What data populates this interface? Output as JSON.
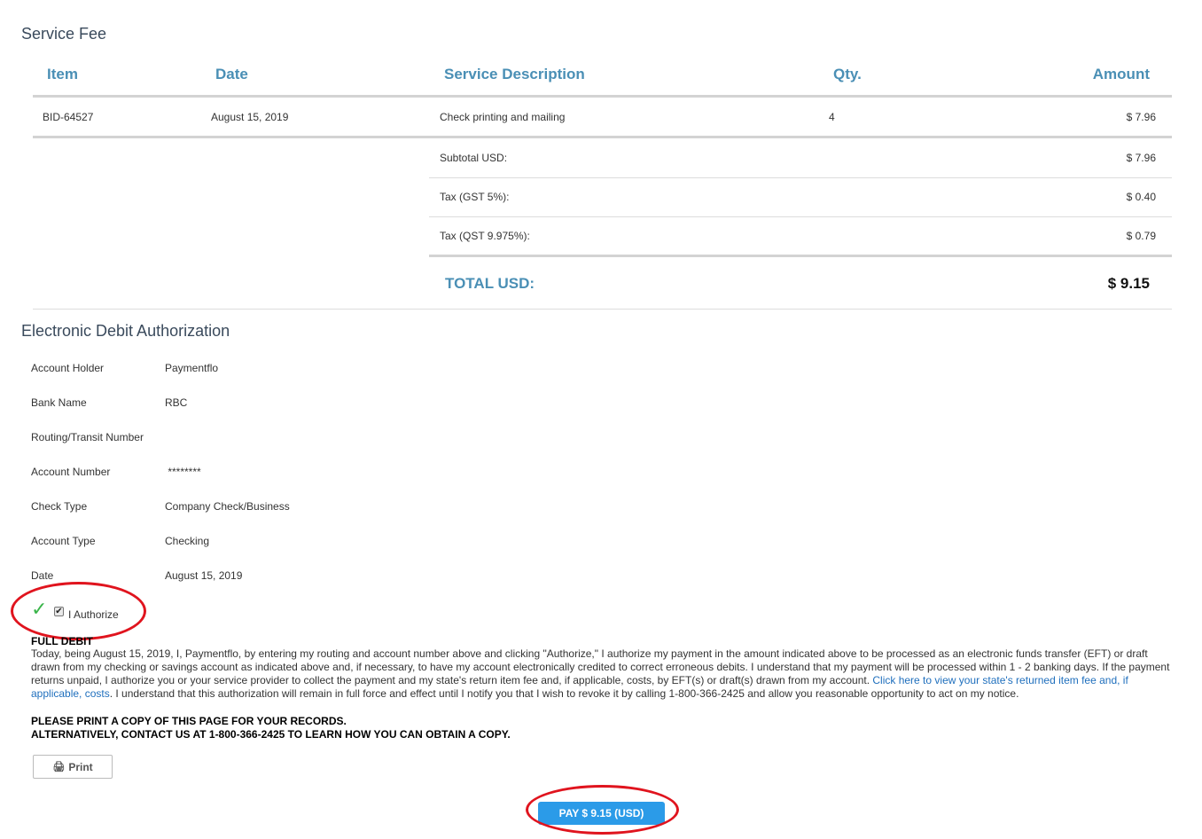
{
  "service_fee": {
    "title": "Service Fee",
    "columns": {
      "item": "Item",
      "date": "Date",
      "description": "Service Description",
      "qty": "Qty.",
      "amount": "Amount"
    },
    "rows": [
      {
        "item": "BID-64527",
        "date": "August 15, 2019",
        "description": "Check printing and mailing",
        "qty": "4",
        "amount": "$ 7.96"
      }
    ],
    "summary": {
      "subtotal_label": "Subtotal USD:",
      "subtotal_value": "$ 7.96",
      "tax_gst_label": "Tax (GST 5%):",
      "tax_gst_value": "$ 0.40",
      "tax_qst_label": "Tax (QST 9.975%):",
      "tax_qst_value": "$ 0.79",
      "total_label": "TOTAL USD:",
      "total_value": "$ 9.15"
    }
  },
  "authorization": {
    "title": "Electronic Debit Authorization",
    "fields": [
      {
        "label": "Account Holder",
        "value": "Paymentflo"
      },
      {
        "label": "Bank Name",
        "value": "RBC"
      },
      {
        "label": "Routing/Transit Number",
        "value": ""
      },
      {
        "label": "Account Number",
        "value": " ********"
      },
      {
        "label": "Check Type",
        "value": "Company Check/Business"
      },
      {
        "label": "Account Type",
        "value": "Checking"
      },
      {
        "label": "Date",
        "value": "August 15, 2019"
      }
    ],
    "checkmark_icon": "✓",
    "checkbox_glyph": "✔",
    "authorize_label": "I Authorize",
    "authorize_checked": true,
    "full_debit_heading": "FULL DEBIT",
    "legal_text": "Today, being August 15, 2019, I, Paymentflo, by entering my routing and account number above and clicking \"Authorize,\" I authorize my payment in the amount indicated above to be processed as an electronic funds transfer (EFT) or draft drawn from my checking or savings account as indicated above and, if necessary, to have my account electronically credited to correct erroneous debits. I understand that my payment will be processed within 1 - 2 banking days. If the payment returns unpaid, I authorize you or your service provider to collect the payment and my state's return item fee and, if applicable, costs, by EFT(s) or draft(s) drawn from my account.",
    "legal_link": "Click here to view your state's returned item fee and, if applicable, costs",
    "legal_text_end": ". I understand that this authorization will remain in full force and effect until I notify you that I wish to revoke it by calling 1-800-366-2425 and allow you reasonable opportunity to act on my notice.",
    "notice_line1": "PLEASE PRINT A COPY OF THIS PAGE FOR YOUR RECORDS.",
    "notice_line2": "ALTERNATIVELY, CONTACT US AT 1-800-366-2425 TO LEARN HOW YOU CAN OBTAIN A COPY.",
    "print_icon": "🖨",
    "print_label": "Print",
    "pay_label": "PAY $ 9.15 (USD)"
  },
  "colors": {
    "accent": "#4a8fb5",
    "pay_button": "#2b9be8",
    "link": "#1f6fbd",
    "annotation": "#e0141e",
    "check": "#3ab54a"
  }
}
